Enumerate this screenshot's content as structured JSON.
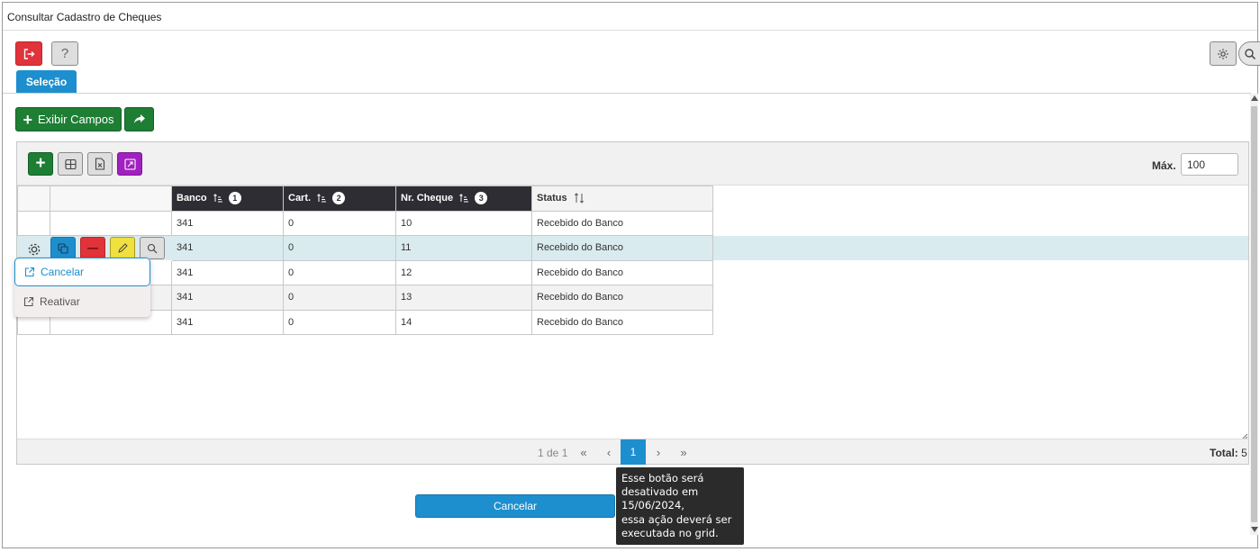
{
  "window": {
    "title": "Consultar Cadastro de Cheques"
  },
  "toolbar": {
    "exit_icon": "exit-icon",
    "help_label": "?",
    "settings_icon": "gear-icon",
    "search_icon": "search-icon"
  },
  "tabs": [
    {
      "label": "Seleção",
      "active": true
    }
  ],
  "actions": {
    "show_fields_label": "Exibir Campos",
    "share_icon": "share-icon"
  },
  "grid": {
    "toolbar": {
      "add_icon": "plus-icon",
      "grid_icon": "table-icon",
      "excel_icon": "excel-icon",
      "expand_icon": "expand-icon"
    },
    "max_label": "Máx.",
    "max_value": "100",
    "columns": [
      {
        "label": "Banco",
        "sort_order": "1"
      },
      {
        "label": "Cart.",
        "sort_order": "2"
      },
      {
        "label": "Nr. Cheque",
        "sort_order": "3"
      },
      {
        "label": "Status"
      }
    ],
    "rows": [
      {
        "banco": "341",
        "cart": "0",
        "nr_cheque": "10",
        "status": "Recebido do Banco"
      },
      {
        "banco": "341",
        "cart": "0",
        "nr_cheque": "11",
        "status": "Recebido do Banco"
      },
      {
        "banco": "341",
        "cart": "0",
        "nr_cheque": "12",
        "status": "Recebido do Banco"
      },
      {
        "banco": "341",
        "cart": "0",
        "nr_cheque": "13",
        "status": "Recebido do Banco"
      },
      {
        "banco": "341",
        "cart": "0",
        "nr_cheque": "14",
        "status": "Recebido do Banco"
      }
    ],
    "selected_row": 1,
    "context_menu": [
      {
        "label": "Cancelar",
        "icon": "external-link-icon"
      },
      {
        "label": "Reativar",
        "icon": "external-link-icon"
      }
    ],
    "pagination": {
      "info": "1 de 1",
      "current_page": "1"
    },
    "total_label": "Total:",
    "total_value": "5"
  },
  "footer": {
    "cancel_label": "Cancelar",
    "tooltip_lines": [
      "Esse botão será",
      "desativado em",
      "15/06/2024,",
      "essa ação deverá ser",
      "executada no grid."
    ]
  },
  "colors": {
    "primary": "#1d8fcf",
    "success": "#1e7e34",
    "danger": "#e0333a",
    "warning": "#f0e040",
    "purple": "#a020c0",
    "header_dark": "#2d2d33",
    "row_selected": "#d9ebef"
  }
}
